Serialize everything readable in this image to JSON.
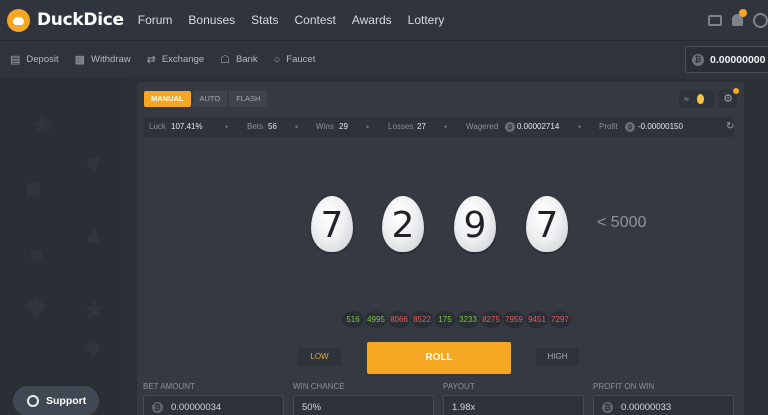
{
  "brand": {
    "name": "DuckDice"
  },
  "nav": [
    "Forum",
    "Bonuses",
    "Stats",
    "Contest",
    "Awards",
    "Lottery"
  ],
  "subnav": [
    {
      "label": "Deposit",
      "icon": "deposit-icon"
    },
    {
      "label": "Withdraw",
      "icon": "withdraw-icon"
    },
    {
      "label": "Exchange",
      "icon": "exchange-icon"
    },
    {
      "label": "Bank",
      "icon": "bank-icon"
    },
    {
      "label": "Faucet",
      "icon": "faucet-icon"
    }
  ],
  "balance": "0.00000000",
  "modes": [
    "MANUAL",
    "AUTO",
    "FLASH"
  ],
  "stats": {
    "luck_label": "Luck",
    "luck": "107.41%",
    "bets_label": "Bets",
    "bets": "56",
    "wins_label": "Wins",
    "wins": "29",
    "losses_label": "Losses",
    "losses": "27",
    "wagered_label": "Wagered",
    "wagered": "0.00002714",
    "profit_label": "Profit",
    "profit": "-0.00000150"
  },
  "roll_digits": [
    "7",
    "2",
    "9",
    "7"
  ],
  "target": "< 5000",
  "history": [
    {
      "value": "516",
      "result": "win"
    },
    {
      "value": "4995",
      "result": "win"
    },
    {
      "value": "8066",
      "result": "lose"
    },
    {
      "value": "8522",
      "result": "lose"
    },
    {
      "value": "175",
      "result": "win"
    },
    {
      "value": "3233",
      "result": "win"
    },
    {
      "value": "8275",
      "result": "lose"
    },
    {
      "value": "7959",
      "result": "lose"
    },
    {
      "value": "9451",
      "result": "lose"
    },
    {
      "value": "7297",
      "result": "lose"
    }
  ],
  "buttons": {
    "low": "LOW",
    "roll": "ROLL",
    "high": "HIGH"
  },
  "inputs": {
    "bet_amount_label": "BET AMOUNT",
    "bet_amount": "0.00000034",
    "win_chance_label": "WIN CHANCE",
    "win_chance": "50%",
    "payout_label": "PAYOUT",
    "payout": "1.98x",
    "profit_label": "PROFIT ON WIN",
    "profit": "0.00000033"
  },
  "support": "Support",
  "colors": {
    "accent": "#f5a623",
    "win": "#7bc44c",
    "lose": "#e25b5b",
    "bg": "#2b3037",
    "panel": "#353a42"
  }
}
